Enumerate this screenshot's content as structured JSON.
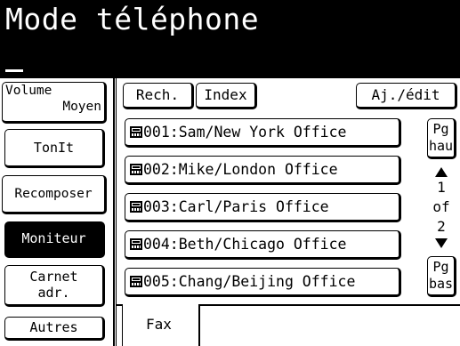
{
  "header": {
    "title": "Mode téléphone"
  },
  "left": {
    "volume_label": "Volume",
    "volume_value": "Moyen",
    "tone_label": "TonIt",
    "redial_label": "Recomposer",
    "monitor_label": "Moniteur",
    "addressbook_line1": "Carnet",
    "addressbook_line2": "adr.",
    "others_label": "Autres"
  },
  "toolbar": {
    "search_label": "Rech.",
    "index_label": "Index",
    "add_edit_label": "Aj./édit"
  },
  "contacts": [
    {
      "label": "001:Sam/New York Office",
      "icon": "fax-icon"
    },
    {
      "label": "002:Mike/London Office",
      "icon": "fax-icon"
    },
    {
      "label": "003:Carl/Paris Office",
      "icon": "fax-icon"
    },
    {
      "label": "004:Beth/Chicago Office",
      "icon": "fax-icon"
    },
    {
      "label": "005:Chang/Beijing Office",
      "icon": "fax-icon"
    }
  ],
  "pager": {
    "page_up_line1": "Pg",
    "page_up_line2": "hau",
    "page_down_line1": "Pg",
    "page_down_line2": "bas",
    "current": "1",
    "of_label": "of",
    "total": "2"
  },
  "tabs": {
    "fax_label": "Fax"
  }
}
